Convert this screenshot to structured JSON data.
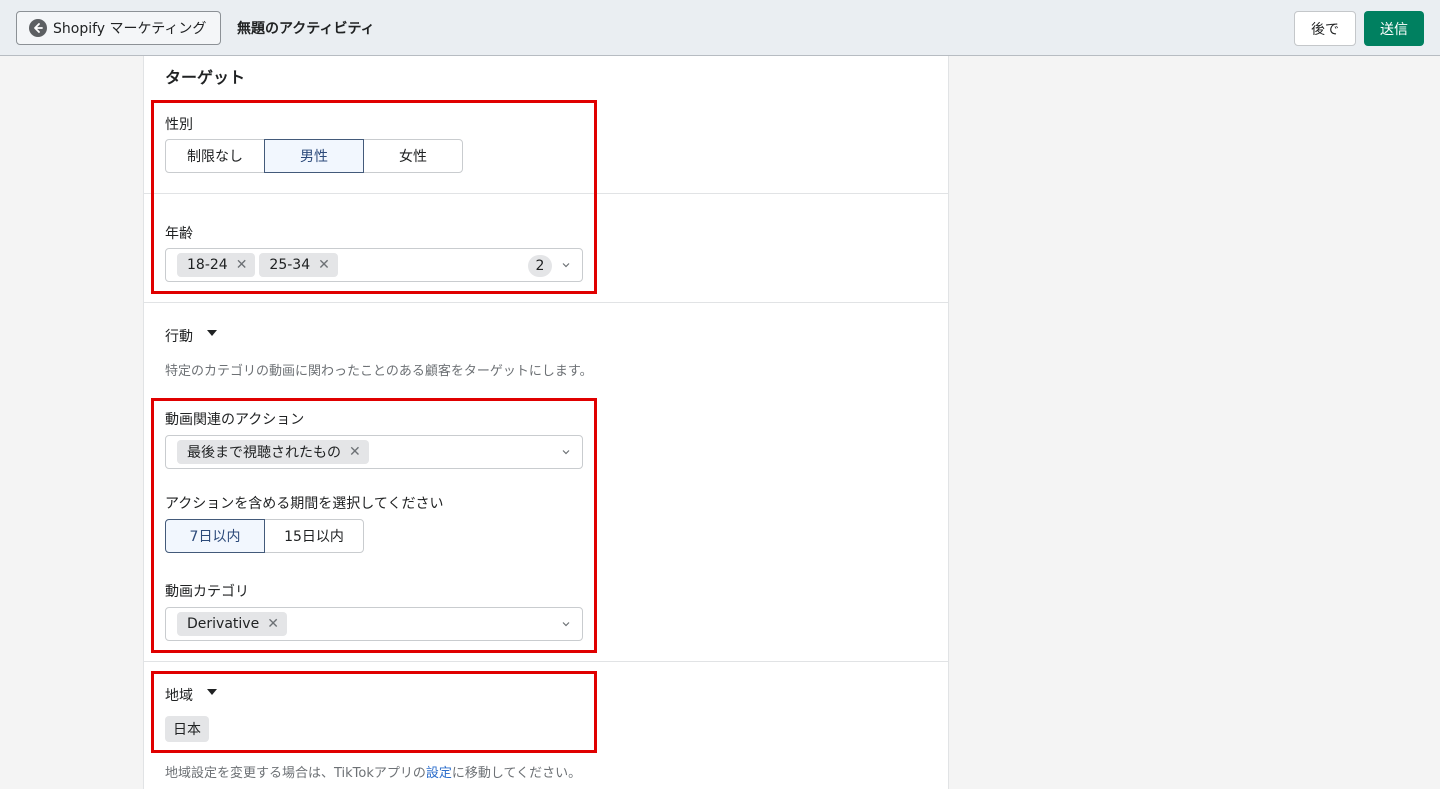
{
  "header": {
    "back_label": "Shopify マーケティング",
    "title": "無題のアクティビティ",
    "later_label": "後で",
    "send_label": "送信"
  },
  "target": {
    "section_title": "ターゲット",
    "gender": {
      "label": "性別",
      "options": [
        "制限なし",
        "男性",
        "女性"
      ],
      "selected": "男性"
    },
    "age": {
      "label": "年齢",
      "tags": [
        "18-24",
        "25-34"
      ],
      "count": "2"
    }
  },
  "behavior": {
    "label": "行動",
    "description": "特定のカテゴリの動画に関わったことのある顧客をターゲットにします。",
    "video_action": {
      "label": "動画関連のアクション",
      "tags": [
        "最後まで視聴されたもの"
      ]
    },
    "period": {
      "label": "アクションを含める期間を選択してください",
      "options": [
        "7日以内",
        "15日以内"
      ],
      "selected": "7日以内"
    },
    "video_category": {
      "label": "動画カテゴリ",
      "tags": [
        "Derivative"
      ]
    }
  },
  "region": {
    "label": "地域",
    "value": "日本",
    "note_before": "地域設定を変更する場合は、TikTokアプリの",
    "note_link": "設定",
    "note_after": "に移動してください。"
  },
  "colors": {
    "primary": "#008060",
    "highlight": "#e00000",
    "active_border": "#435a7a",
    "link": "#2c6ecb"
  }
}
